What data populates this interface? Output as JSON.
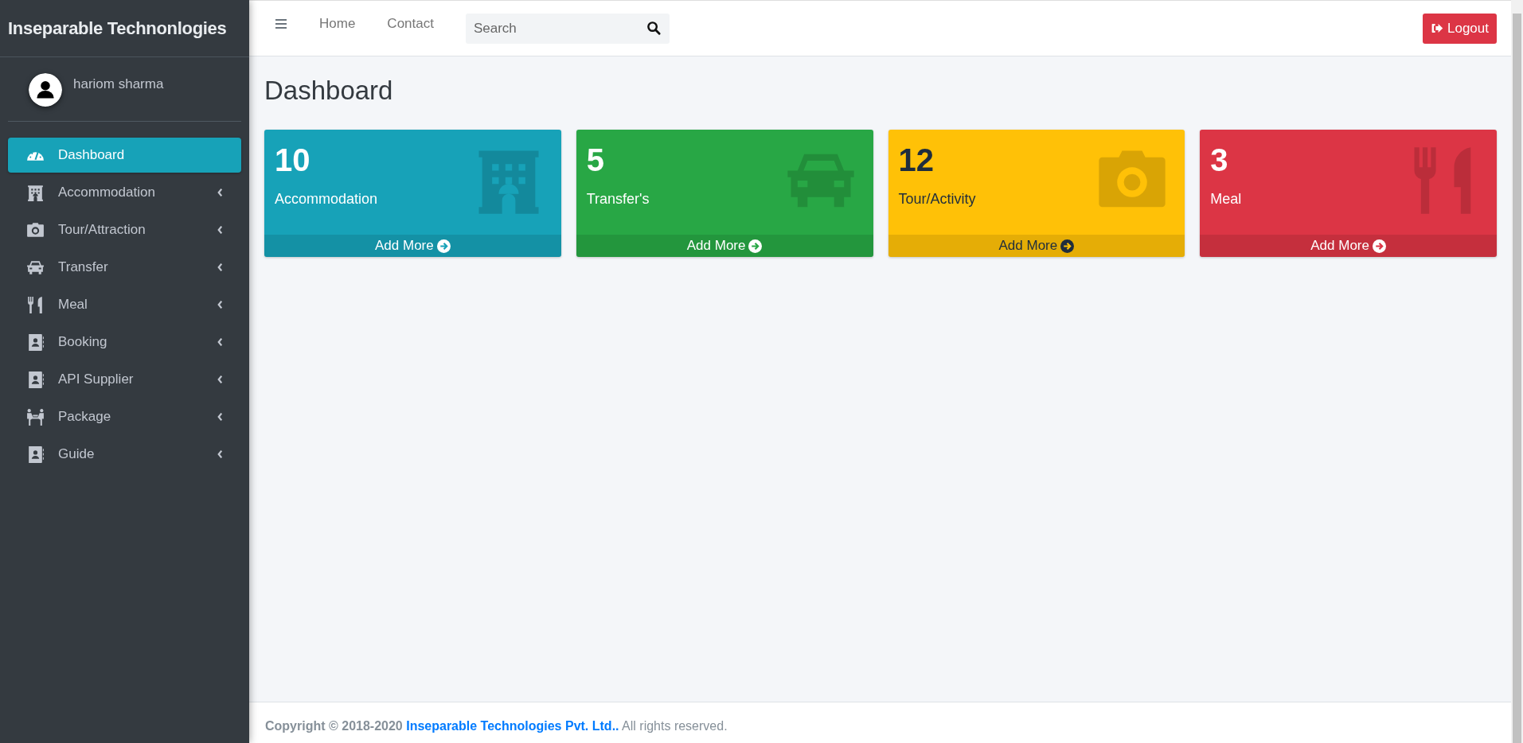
{
  "brand": "Inseparable Technonlogies",
  "user": {
    "name": "hariom sharma"
  },
  "sidebar": {
    "items": [
      {
        "label": "Dashboard",
        "kind": "gauge",
        "selected": true,
        "has_submenu": false
      },
      {
        "label": "Accommodation",
        "kind": "building",
        "selected": false,
        "has_submenu": true
      },
      {
        "label": "Tour/Attraction",
        "kind": "camera",
        "selected": false,
        "has_submenu": true
      },
      {
        "label": "Transfer",
        "kind": "car",
        "selected": false,
        "has_submenu": true
      },
      {
        "label": "Meal",
        "kind": "utensils",
        "selected": false,
        "has_submenu": true
      },
      {
        "label": "Booking",
        "kind": "contact",
        "selected": false,
        "has_submenu": true
      },
      {
        "label": "API Supplier",
        "kind": "contact",
        "selected": false,
        "has_submenu": true
      },
      {
        "label": "Package",
        "kind": "people",
        "selected": false,
        "has_submenu": true
      },
      {
        "label": "Guide",
        "kind": "contact",
        "selected": false,
        "has_submenu": true
      }
    ]
  },
  "navbar": {
    "links": [
      "Home",
      "Contact"
    ],
    "search": {
      "placeholder": "Search"
    },
    "logout": "Logout"
  },
  "page_title": "Dashboard",
  "cards": [
    {
      "count": "10",
      "label": "Accommodation",
      "kind": "building",
      "color": "#17a2b8",
      "footer": "Add More"
    },
    {
      "count": "5",
      "label": "Transfer's",
      "kind": "car",
      "color": "#28a745",
      "footer": "Add More"
    },
    {
      "count": "12",
      "label": "Tour/Activity",
      "kind": "camera",
      "color": "#ffc107",
      "footer": "Add More"
    },
    {
      "count": "3",
      "label": "Meal",
      "kind": "utensils",
      "color": "#dc3545",
      "footer": "Add More"
    }
  ],
  "footer": {
    "prefix": "Copyright © 2018-2020",
    "link": "Inseparable Technologies Pvt. Ltd..",
    "suffix": "All rights reserved."
  }
}
